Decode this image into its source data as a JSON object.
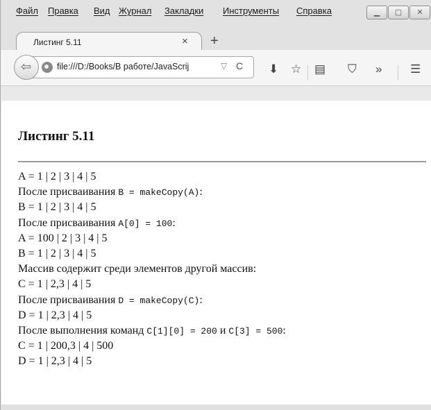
{
  "menubar": {
    "items": [
      "Файл",
      "Правка",
      "Вид",
      "Журнал",
      "Закладки",
      "Инструменты",
      "Справка"
    ]
  },
  "window_controls": {
    "minimize_icon": "minimize-icon",
    "maximize_icon": "maximize-icon",
    "close_icon": "close-icon"
  },
  "tab": {
    "title": "Листинг 5.11",
    "close_glyph": "×",
    "new_tab_glyph": "+"
  },
  "navbar": {
    "url": "file:///D:/Books/В работе/JavaScrij",
    "icons": [
      "back-arrow-icon",
      "globe-icon",
      "dropdown-icon",
      "reload-icon",
      "download-icon",
      "bookmark-star-icon",
      "reading-list-icon",
      "pocket-icon",
      "overflow-icon",
      "menu-icon"
    ]
  },
  "page": {
    "title": "Листинг 5.11",
    "lines": [
      {
        "text": "A = 1 | 2 | 3 | 4 | 5"
      },
      {
        "text": "После присваивания ",
        "code": "B = makeCopy(A)",
        "suffix": ":"
      },
      {
        "text": "B = 1 | 2 | 3 | 4 | 5"
      },
      {
        "text": "После присваивания ",
        "code": "A[0] = 100",
        "suffix": ":"
      },
      {
        "text": "A = 100 | 2 | 3 | 4 | 5"
      },
      {
        "text": "B = 1 | 2 | 3 | 4 | 5"
      },
      {
        "text": "Массив содержит среди элементов другой массив:"
      },
      {
        "text": "C = 1 | 2,3 | 4 | 5"
      },
      {
        "text": "После присваивания ",
        "code": "D = makeCopy(C)",
        "suffix": ":"
      },
      {
        "text": "D = 1 | 2,3 | 4 | 5"
      },
      {
        "text": "После выполнения команд ",
        "code": "C[1][0] = 200",
        "mid": " и ",
        "code2": "C[3] = 500",
        "suffix": ":"
      },
      {
        "text": "C = 1 | 200,3 | 4 | 500"
      },
      {
        "text": "D = 1 | 2,3 | 4 | 5"
      }
    ]
  }
}
